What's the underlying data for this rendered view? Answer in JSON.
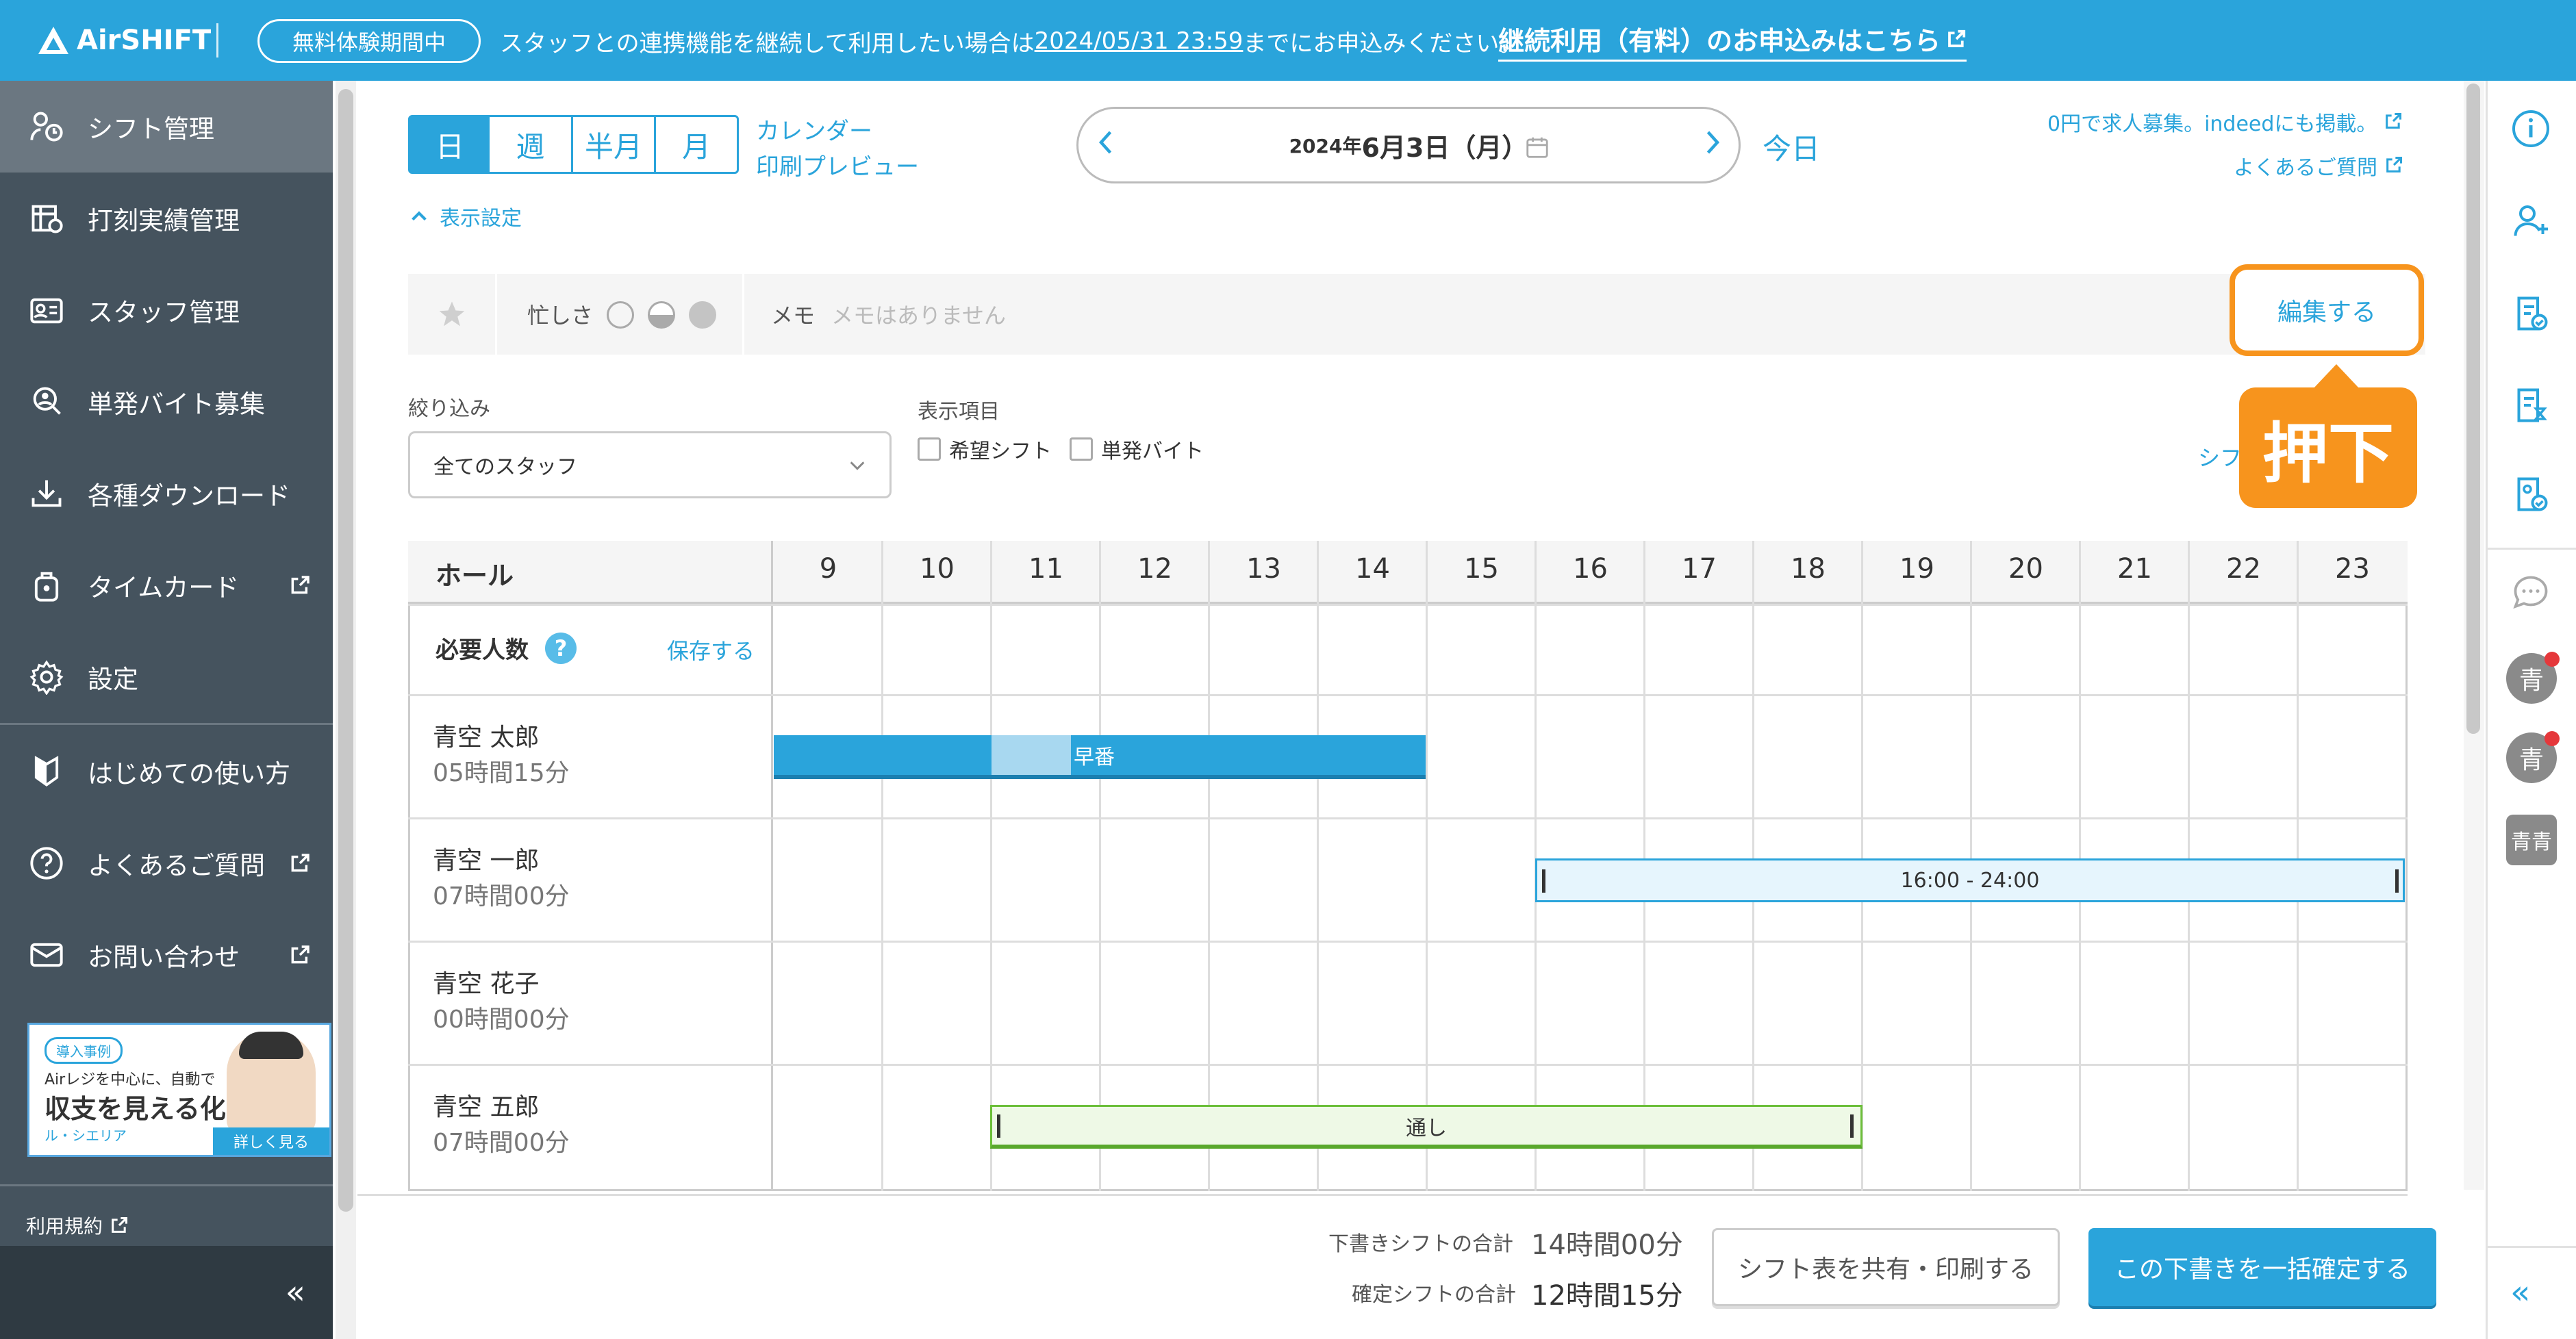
{
  "banner": {
    "logo": "AirSHIFT",
    "trial_badge": "無料体験期間中",
    "message_prefix": "スタッフとの連携機能を継続して利用したい場合は",
    "message_deadline": "2024/05/31 23:59",
    "message_suffix": "までにお申込みください。",
    "cta": "継続利用（有料）のお申込みはこちら"
  },
  "sidebar": {
    "items": [
      {
        "label": "シフト管理",
        "icon": "shift-icon"
      },
      {
        "label": "打刻実績管理",
        "icon": "timestamp-icon"
      },
      {
        "label": "スタッフ管理",
        "icon": "staff-card-icon"
      },
      {
        "label": "単発バイト募集",
        "icon": "recruit-icon"
      },
      {
        "label": "各種ダウンロード",
        "icon": "download-icon"
      },
      {
        "label": "タイムカード",
        "icon": "timecard-icon"
      },
      {
        "label": "設定",
        "icon": "gear-icon"
      },
      {
        "label": "はじめての使い方",
        "icon": "beginner-icon"
      },
      {
        "label": "よくあるご質問",
        "icon": "question-icon"
      },
      {
        "label": "お問い合わせ",
        "icon": "mail-icon"
      }
    ],
    "ad": {
      "badge": "導入事例",
      "line1": "Airレジを中心に、自動で",
      "line2": "収支を見える化",
      "line3": "ル・シエリア",
      "button": "詳しく見る"
    },
    "terms": "利用規約",
    "collapse": "«"
  },
  "view": {
    "modes": [
      "日",
      "週",
      "半月",
      "月"
    ],
    "print_preview_line1": "カレンダー",
    "print_preview_line2": "印刷プレビュー",
    "date_prefix": "2024年",
    "date_main": "6月3日（月）",
    "today": "今日",
    "job_link": "0円で求人募集。indeedにも掲載。",
    "faq_link": "よくあるご質問",
    "display_settings": "表示設定"
  },
  "memo_row": {
    "busy_label": "忙しさ",
    "memo_label": "メモ",
    "memo_text": "メモはありません",
    "edit_button": "編集する",
    "callout": "押下",
    "cut_text": "シフ"
  },
  "filter": {
    "label": "絞り込み",
    "selected": "全てのスタッフ",
    "display_items_label": "表示項目",
    "checkbox_wish": "希望シフト",
    "checkbox_oneoff": "単発バイト"
  },
  "grid": {
    "section": "ホール",
    "hours": [
      "9",
      "10",
      "11",
      "12",
      "13",
      "14",
      "15",
      "16",
      "17",
      "18",
      "19",
      "20",
      "21",
      "22",
      "23"
    ],
    "required_label": "必要人数",
    "required_help": "?",
    "save": "保存する",
    "staff": [
      {
        "name": "青空 太郎",
        "hours": "05時間15分",
        "shift_label": "早番"
      },
      {
        "name": "青空 一郎",
        "hours": "07時間00分",
        "shift_label": "16:00 - 24:00"
      },
      {
        "name": "青空 花子",
        "hours": "00時間00分",
        "shift_label": ""
      },
      {
        "name": "青空 五郎",
        "hours": "07時間00分",
        "shift_label": "通し"
      }
    ]
  },
  "footer": {
    "draft_total_label": "下書きシフトの合計",
    "draft_total": "14時間00分",
    "confirm_total_label": "確定シフトの合計",
    "confirm_total": "12時間15分",
    "share_button": "シフト表を共有・印刷する",
    "confirm_button": "この下書きを一括確定する"
  },
  "right_rail": {
    "avatars": [
      "青",
      "青",
      "青青"
    ],
    "collapse": "«"
  },
  "colors": {
    "brand": "#2aa4db",
    "sidebar": "#45535e",
    "highlight": "#f7941d"
  }
}
